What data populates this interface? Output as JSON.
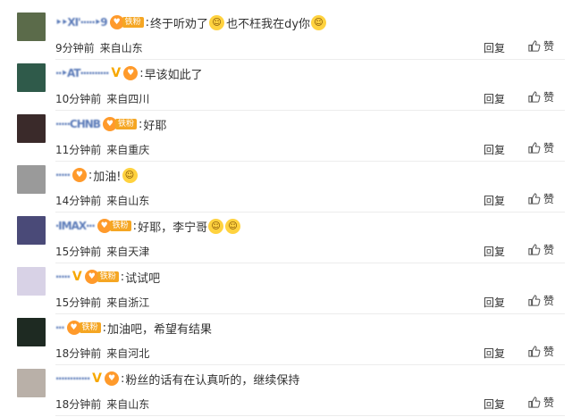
{
  "actions": {
    "reply_label": "回复",
    "like_label": "赞"
  },
  "comments": [
    {
      "name": "‣‣XI'‧‧‧‧‧‣9",
      "verified": false,
      "fan_badge": true,
      "fan_text": "铁粉",
      "text": "终于听劝了",
      "emoji1": "emoji-cat",
      "text2": "也不枉我在dy你",
      "emoji2": "emoji-heart-eyes",
      "time": "9分钟前",
      "source": "来自山东",
      "avatar_color": "#5b6b4a"
    },
    {
      "name": "‧‧‣AT‧‧‧‧‧‧‧‧‧‧",
      "verified": true,
      "fan_badge": true,
      "fan_text": "",
      "text": "早该如此了",
      "time": "10分钟前",
      "source": "来自四川",
      "avatar_color": "#2f5a4a"
    },
    {
      "name": "‧‧‧‧‧CHNB",
      "verified": false,
      "fan_badge": true,
      "fan_text": "铁粉",
      "text": "好耶",
      "time": "11分钟前",
      "source": "来自重庆",
      "avatar_color": "#3a2a2a"
    },
    {
      "name": "‧‧‧‧‧",
      "verified": false,
      "fan_badge": true,
      "fan_text": "",
      "text": "加油!",
      "emoji1": "emoji-cry",
      "time": "14分钟前",
      "source": "来自山东",
      "avatar_color": "#9a9a9a"
    },
    {
      "name": "‧IMAX‧‧‧",
      "verified": false,
      "fan_badge": true,
      "fan_text": "铁粉",
      "text": "好耶，李宁哥",
      "emoji1": "emoji-heart-eyes",
      "emoji2": "emoji-heart-eyes",
      "time": "15分钟前",
      "source": "来自天津",
      "avatar_color": "#4a4a78"
    },
    {
      "name": "‧‧‧‧‧",
      "verified": true,
      "fan_badge": true,
      "fan_text": "铁粉",
      "text": "试试吧",
      "time": "15分钟前",
      "source": "来自浙江",
      "avatar_color": "#d8d2e6"
    },
    {
      "name": "‧‧‧",
      "verified": false,
      "fan_badge": true,
      "fan_text": "铁粉",
      "text": "加油吧，希望有结果",
      "time": "18分钟前",
      "source": "来自河北",
      "avatar_color": "#1e2a22"
    },
    {
      "name": "‧‧‧‧‧‧‧‧‧‧‧‧",
      "verified": true,
      "fan_badge": true,
      "fan_text": "",
      "text": "粉丝的话有在认真听的，继续保持",
      "time": "18分钟前",
      "source": "来自山东",
      "avatar_color": "#b9b0a8"
    }
  ]
}
